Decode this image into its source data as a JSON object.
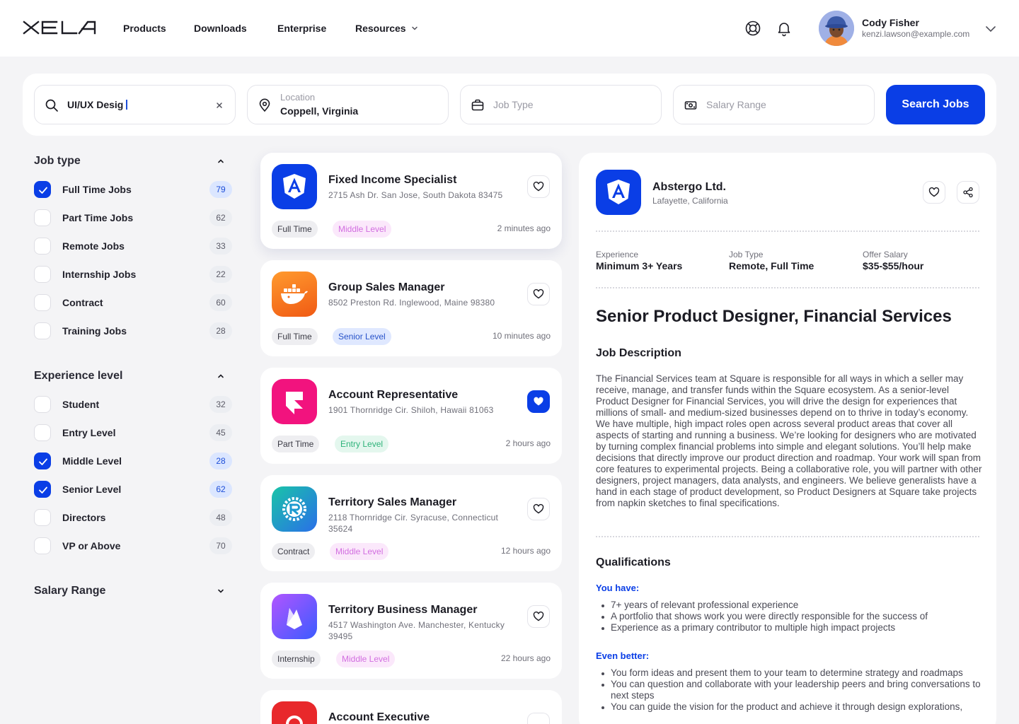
{
  "header": {
    "logo_text": "XELA",
    "nav": [
      {
        "label": "Products"
      },
      {
        "label": "Downloads"
      },
      {
        "label": "Enterprise"
      },
      {
        "label": "Resources"
      }
    ],
    "user": {
      "name": "Cody Fisher",
      "email": "kenzi.lawson@example.com"
    }
  },
  "search": {
    "keyword_value": "UI/UX Desig",
    "location_label": "Location",
    "location_value": "Coppell, Virginia",
    "job_type_placeholder": "Job Type",
    "salary_placeholder": "Salary Range",
    "button_label": "Search Jobs"
  },
  "filters": {
    "job_type": {
      "title": "Job type",
      "items": [
        {
          "label": "Full Time Jobs",
          "count": "79",
          "checked": true
        },
        {
          "label": "Part Time Jobs",
          "count": "62",
          "checked": false
        },
        {
          "label": "Remote Jobs",
          "count": "33",
          "checked": false
        },
        {
          "label": "Internship Jobs",
          "count": "22",
          "checked": false
        },
        {
          "label": "Contract",
          "count": "60",
          "checked": false
        },
        {
          "label": "Training Jobs",
          "count": "28",
          "checked": false
        }
      ]
    },
    "experience": {
      "title": "Experience level",
      "items": [
        {
          "label": "Student",
          "count": "32",
          "checked": false
        },
        {
          "label": "Entry Level",
          "count": "45",
          "checked": false
        },
        {
          "label": "Middle Level",
          "count": "28",
          "checked": true
        },
        {
          "label": "Senior Level",
          "count": "62",
          "checked": true
        },
        {
          "label": "Directors",
          "count": "48",
          "checked": false
        },
        {
          "label": "VP or Above",
          "count": "70",
          "checked": false
        }
      ]
    },
    "salary": {
      "title": "Salary Range"
    }
  },
  "jobs": [
    {
      "title": "Fixed Income Specialist",
      "address": "2715 Ash Dr. San Jose, South Dakota 83475",
      "type": "Full Time",
      "level": "Middle Level",
      "time": "2 minutes ago",
      "favorited": false,
      "logo_color": "#0a3ee6",
      "logo_icon": "angular-icon"
    },
    {
      "title": "Group Sales Manager",
      "address": "8502 Preston Rd. Inglewood, Maine 98380",
      "type": "Full Time",
      "level": "Senior Level",
      "time": "10 minutes ago",
      "favorited": false,
      "logo_color": "#f26a1b",
      "logo_icon": "docker-icon"
    },
    {
      "title": "Account Representative",
      "address": "1901 Thornridge Cir. Shiloh, Hawaii 81063",
      "type": "Part Time",
      "level": "Entry Level",
      "time": "2 hours ago",
      "favorited": true,
      "logo_color": "#f2137e",
      "logo_icon": "framer-icon"
    },
    {
      "title": "Territory Sales Manager",
      "address": "2118 Thornridge Cir. Syracuse, Connecticut 35624",
      "type": "Contract",
      "level": "Middle Level",
      "time": "12 hours ago",
      "favorited": false,
      "logo_color": "#1fb7c9",
      "logo_icon": "rust-icon"
    },
    {
      "title": "Territory Business Manager",
      "address": "4517 Washington Ave. Manchester, Kentucky 39495",
      "type": "Internship",
      "level": "Middle Level",
      "time": "22 hours ago",
      "favorited": false,
      "logo_color": "#7c4dff",
      "logo_icon": "firebase-icon"
    },
    {
      "title": "Account Executive",
      "address": "",
      "type": "",
      "level": "",
      "time": "",
      "favorited": false,
      "logo_color": "#e8282b",
      "logo_icon": "brand-icon"
    }
  ],
  "detail": {
    "company": "Abstergo Ltd.",
    "location": "Lafayette, California",
    "meta": [
      {
        "label": "Experience",
        "value": "Minimum 3+ Years"
      },
      {
        "label": "Job Type",
        "value": "Remote, Full Time"
      },
      {
        "label": "Offer Salary",
        "value": "$35-$55/hour"
      }
    ],
    "title": "Senior Product Designer, Financial Services",
    "description_heading": "Job Description",
    "description": "The Financial Services team at Square is responsible for all ways in which a seller may receive, manage, and transfer funds within the Square ecosystem. As a senior-level Product Designer for Financial Services, you will drive the design for experiences that millions of small- and medium-sized businesses depend on to thrive in today’s economy. We have multiple, high impact roles open across several product areas that cover all aspects of starting and running a business. We’re looking for designers who are motivated by turning complex financial problems into simple and elegant solutions. You’ll help make decisions that directly improve our product direction and roadmap. Your work will span from core features to experimental projects. Being a collaborative role, you will partner with other designers, project managers, data analysts, and engineers. We believe generalists have a hand in each stage of product development, so Product Designers at Square take projects from napkin sketches to final specifications.",
    "qualifications_heading": "Qualifications",
    "you_have_label": "You have:",
    "you_have": [
      "7+ years of relevant professional experience",
      "A portfolio that shows work you were directly responsible for the success of",
      "Experience as a primary contributor to multiple high impact projects"
    ],
    "even_better_label": "Even better:",
    "even_better": [
      "You form ideas and present them to your team to determine strategy and roadmaps",
      "You can question and collaborate with your leadership peers and bring conversations to next steps",
      "You can guide the vision for the product and achieve it through design explorations,"
    ]
  },
  "colors": {
    "primary": "#0a3ee6",
    "tag_pink": "#d26ee0",
    "tag_blue": "#2752c9",
    "tag_green": "#2eb37a"
  }
}
